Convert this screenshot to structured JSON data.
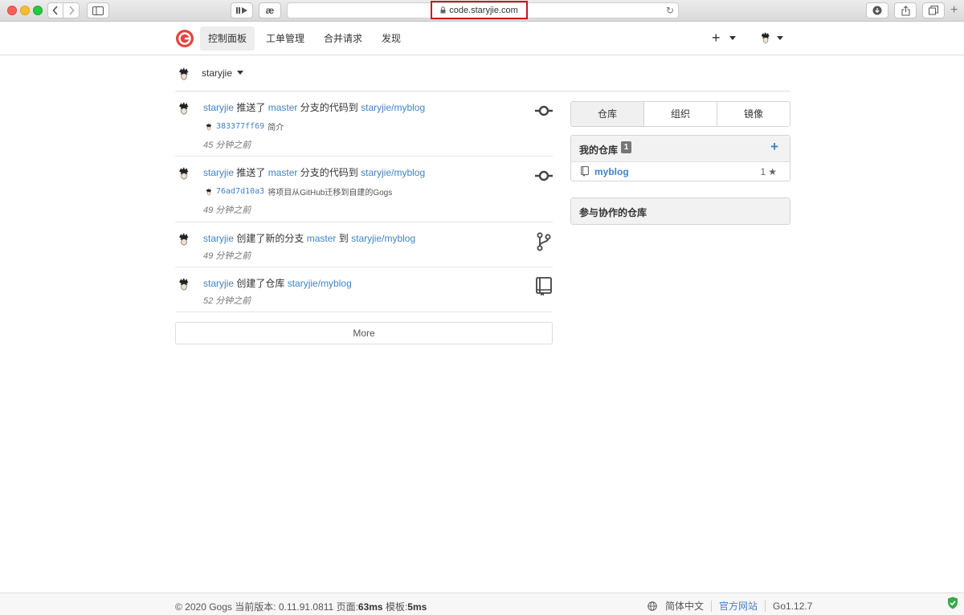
{
  "browser": {
    "url": "code.staryjie.com"
  },
  "header": {
    "nav": [
      "控制面板",
      "工单管理",
      "合并请求",
      "发现"
    ]
  },
  "context": {
    "username": "staryjie"
  },
  "feed": [
    {
      "user": "staryjie",
      "verb": "推送了",
      "branch": "master",
      "mid": "分支的代码到",
      "repo": "staryjie/myblog",
      "commit_sha": "383377ff69",
      "commit_msg": "简介",
      "time": "45 分钟之前",
      "icon": "commit-icon"
    },
    {
      "user": "staryjie",
      "verb": "推送了",
      "branch": "master",
      "mid": "分支的代码到",
      "repo": "staryjie/myblog",
      "commit_sha": "76ad7d10a3",
      "commit_msg": "将项目从GitHub迁移到自建的Gogs",
      "time": "49 分钟之前",
      "icon": "commit-icon"
    },
    {
      "user": "staryjie",
      "verb": "创建了新的分支",
      "branch": "master",
      "mid": "到",
      "repo": "staryjie/myblog",
      "time": "49 分钟之前",
      "icon": "branch-icon"
    },
    {
      "user": "staryjie",
      "verb": "创建了仓库",
      "repo": "staryjie/myblog",
      "time": "52 分钟之前",
      "icon": "repo-book-icon"
    }
  ],
  "more_label": "More",
  "panel": {
    "tabs": [
      "仓库",
      "组织",
      "镜像"
    ],
    "my_repos_title": "我的仓库",
    "my_repos_count": "1",
    "repos": [
      {
        "name": "myblog",
        "stars": "1"
      }
    ],
    "collab_title": "参与协作的仓库"
  },
  "footer": {
    "copyright": "© 2020 Gogs",
    "version_label": "当前版本:",
    "version": "0.11.91.0811",
    "page_label": "页面:",
    "page_time": "63ms",
    "tpl_label": "模板:",
    "tpl_time": "5ms",
    "language": "简体中文",
    "website": "官方网站",
    "go_version": "Go1.12.7"
  },
  "colors": {
    "link": "#4183c4",
    "logo": "#e2463e",
    "url_highlight": "#d0121b"
  }
}
